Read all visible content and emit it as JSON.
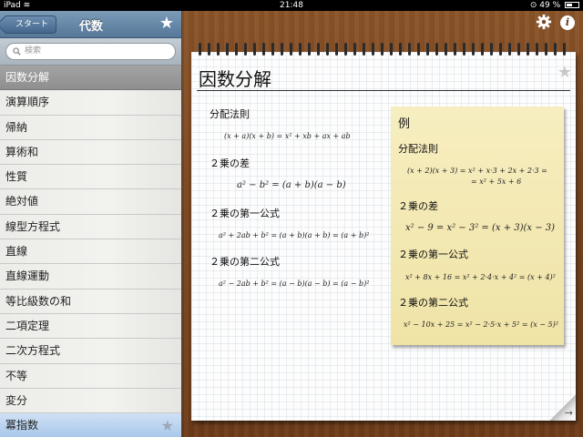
{
  "status_bar": {
    "device": "iPad",
    "time": "21:48",
    "battery": "49 %"
  },
  "sidebar": {
    "back_label": "スタート",
    "title": "代数",
    "search_placeholder": "検索",
    "items": [
      {
        "label": "因数分解",
        "state": "header"
      },
      {
        "label": "演算順序"
      },
      {
        "label": "帰納"
      },
      {
        "label": "算術和"
      },
      {
        "label": "性質"
      },
      {
        "label": "絶対値"
      },
      {
        "label": "線型方程式"
      },
      {
        "label": "直線"
      },
      {
        "label": "直線運動"
      },
      {
        "label": "等比級数の和"
      },
      {
        "label": "二項定理"
      },
      {
        "label": "二次方程式"
      },
      {
        "label": "不等"
      },
      {
        "label": "変分"
      },
      {
        "label": "冪指数",
        "state": "selected"
      }
    ]
  },
  "page": {
    "title": "因数分解",
    "sections": [
      {
        "heading": "分配法則",
        "formula": "(x + a)(x + b) = x² + xb + ax + ab"
      },
      {
        "heading": "２乗の差",
        "formula": "a² − b² = (a + b)(a − b)"
      },
      {
        "heading": "２乗の第一公式",
        "formula": "a² + 2ab + b² = (a + b)(a + b) = (a + b)²"
      },
      {
        "heading": "２乗の第二公式",
        "formula": "a² − 2ab + b² = (a − b)(a − b) = (a − b)²"
      }
    ],
    "example": {
      "title": "例",
      "sections": [
        {
          "heading": "分配法則",
          "formula": "(x + 2)(x + 3) = x² + x·3 + 2x + 2·3 =",
          "formula2": "= x² + 5x + 6"
        },
        {
          "heading": "２乗の差",
          "formula": "x² − 9 = x² − 3² = (x + 3)(x − 3)"
        },
        {
          "heading": "２乗の第一公式",
          "formula": "x² + 8x + 16 = x² + 2·4·x + 4² = (x + 4)²"
        },
        {
          "heading": "２乗の第二公式",
          "formula": "x² − 10x + 25 = x² − 2·5·x + 5² = (x − 5)²"
        }
      ]
    }
  },
  "icons": [
    "wifi-icon",
    "lock-rotation-icon",
    "battery-icon",
    "star-icon",
    "search-icon",
    "gear-icon",
    "info-icon",
    "page-curl-icon"
  ]
}
